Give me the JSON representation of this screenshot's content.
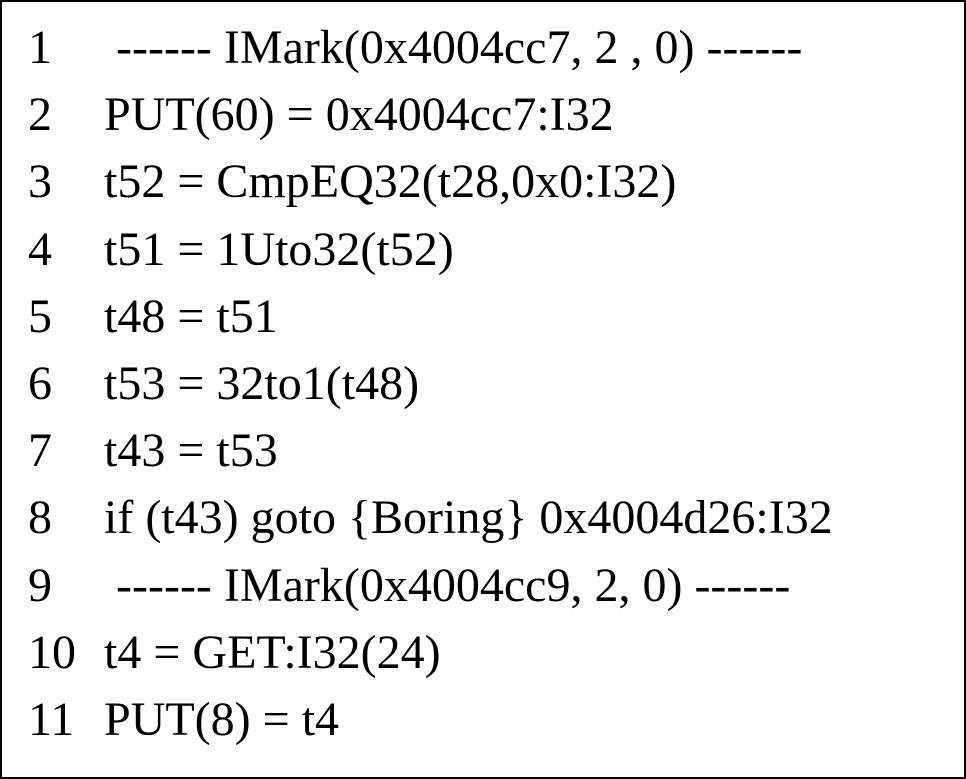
{
  "code": {
    "lines": [
      {
        "num": "1",
        "text": "  ------ IMark(0x4004cc7, 2 , 0) ------",
        "indent": false
      },
      {
        "num": "2",
        "text": " PUT(60) = 0x4004cc7:I32",
        "indent": false
      },
      {
        "num": "3",
        "text": " t52 = CmpEQ32(t28,0x0:I32)",
        "indent": false
      },
      {
        "num": "4",
        "text": " t51 = 1Uto32(t52)",
        "indent": false
      },
      {
        "num": "5",
        "text": " t48 = t51",
        "indent": false
      },
      {
        "num": "6",
        "text": " t53 = 32to1(t48)",
        "indent": false
      },
      {
        "num": "7",
        "text": " t43 = t53",
        "indent": false
      },
      {
        "num": "8",
        "text": " if (t43) goto {Boring} 0x4004d26:I32",
        "indent": false
      },
      {
        "num": "9",
        "text": "  ------ IMark(0x4004cc9, 2, 0) ------",
        "indent": false
      },
      {
        "num": "10",
        "text": " t4 = GET:I32(24)",
        "indent": false
      },
      {
        "num": "11",
        "text": " PUT(8) = t4",
        "indent": false
      }
    ]
  }
}
